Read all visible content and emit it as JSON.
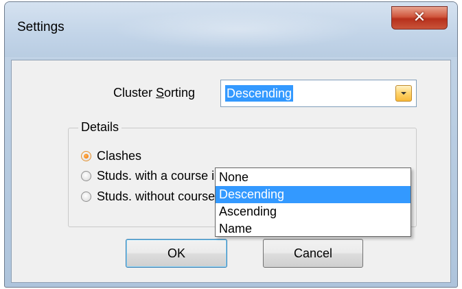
{
  "window": {
    "title": "Settings",
    "close_symbol": "✕"
  },
  "sorting": {
    "label_prefix": "Cluster ",
    "label_mnemonic": "S",
    "label_suffix": "orting",
    "selected_value": "Descending",
    "options": [
      "None",
      "Descending",
      "Ascending",
      "Name"
    ],
    "selected_index": 1
  },
  "details": {
    "group_title": "Details",
    "options": [
      {
        "label": "Clashes",
        "checked": true
      },
      {
        "label": "Studs. with a course in the cluster",
        "checked": false
      },
      {
        "label": "Studs. without course in cluster",
        "checked": false
      }
    ]
  },
  "buttons": {
    "ok_label": "OK",
    "cancel_label": "Cancel"
  },
  "colors": {
    "selection": "#3399ff",
    "close_button": "#c9543a",
    "radio_checked": "#f07d13"
  }
}
